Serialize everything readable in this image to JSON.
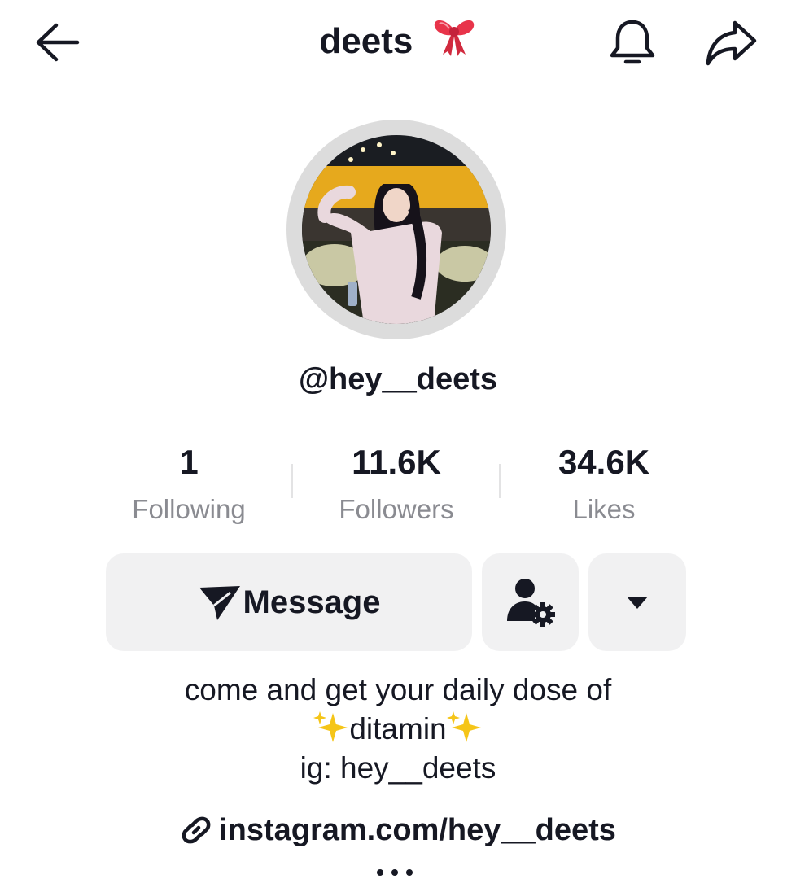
{
  "header": {
    "title": "deets",
    "title_emoji": "🎀",
    "icons": [
      "arrow-left-icon",
      "bell-icon",
      "share-icon"
    ]
  },
  "profile": {
    "username": "@hey__deets"
  },
  "stats": {
    "following": {
      "value": "1",
      "label": "Following"
    },
    "followers": {
      "value": "11.6K",
      "label": "Followers"
    },
    "likes": {
      "value": "34.6K",
      "label": "Likes"
    }
  },
  "actions": {
    "message_label": "Message",
    "icons": [
      "send-icon",
      "friend-settings-icon",
      "caret-down-icon"
    ]
  },
  "bio": {
    "line1": "come and get your daily dose of",
    "line2_text": "ditamin",
    "line3": "ig: hey__deets"
  },
  "link": {
    "url": "instagram.com/hey__deets",
    "icon": "link-icon"
  },
  "colors": {
    "text": "#161823",
    "muted": "#8a8b91",
    "button_bg": "#f1f1f2",
    "avatar_ring": "#dcdcdc",
    "bow": "#e8344a",
    "sparkle": "#f5c518"
  }
}
